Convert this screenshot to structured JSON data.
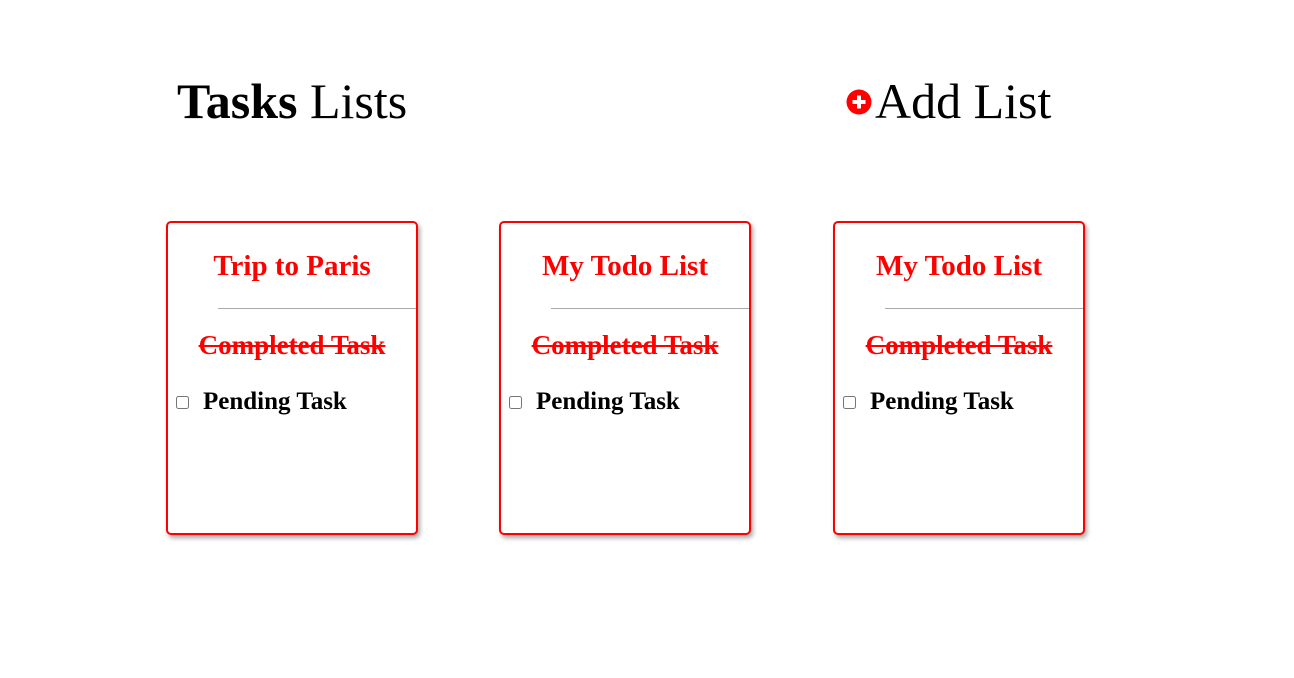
{
  "header": {
    "title_bold": "Tasks",
    "title_rest": "Lists",
    "add_list_label": "Add List",
    "add_icon": "plus-circle-icon",
    "accent_color": "#ff0000"
  },
  "lists": [
    {
      "title": "Trip to Paris",
      "completed_task": "Completed Task",
      "pending_task": "Pending Task",
      "pending_checked": false
    },
    {
      "title": "My Todo List",
      "completed_task": "Completed Task",
      "pending_task": "Pending Task",
      "pending_checked": false
    },
    {
      "title": "My Todo List",
      "completed_task": "Completed Task",
      "pending_task": "Pending Task",
      "pending_checked": false
    }
  ]
}
